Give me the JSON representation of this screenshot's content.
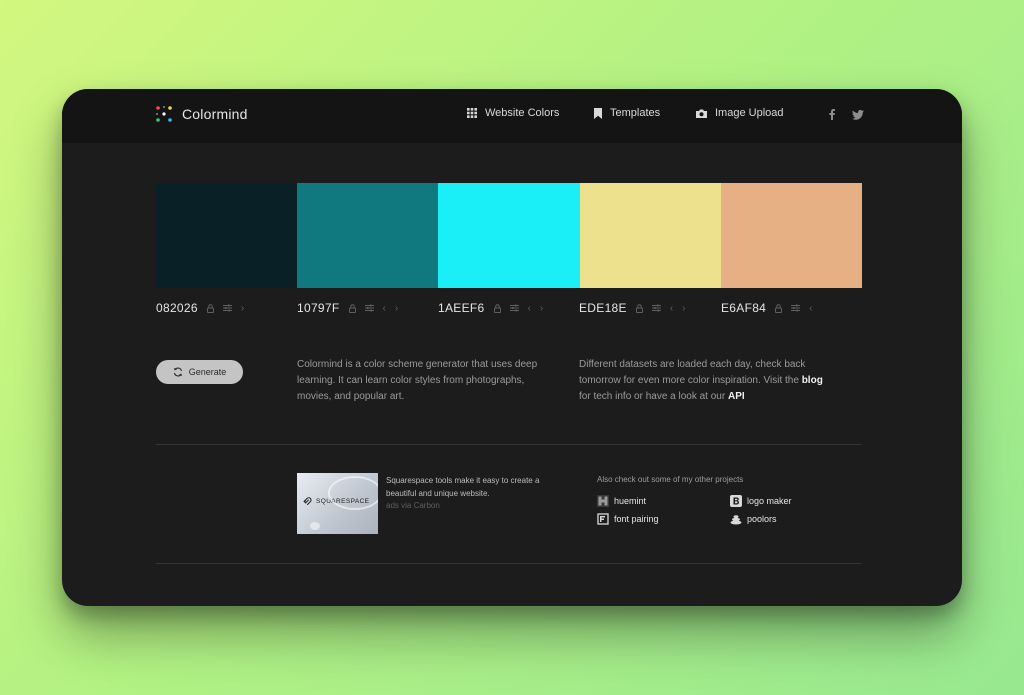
{
  "app": {
    "name": "Colormind"
  },
  "nav": {
    "items": [
      {
        "label": "Website Colors",
        "icon": "grid-icon"
      },
      {
        "label": "Templates",
        "icon": "bookmark-icon"
      },
      {
        "label": "Image Upload",
        "icon": "camera-icon"
      }
    ],
    "social": [
      "facebook-icon",
      "twitter-icon"
    ]
  },
  "palette": [
    {
      "hex": "082026",
      "color": "#082026"
    },
    {
      "hex": "10797F",
      "color": "#10797F"
    },
    {
      "hex": "1AEEF6",
      "color": "#1AEEF6"
    },
    {
      "hex": "EDE18E",
      "color": "#EDE18E"
    },
    {
      "hex": "E6AF84",
      "color": "#E6AF84"
    }
  ],
  "generate": {
    "label": "Generate"
  },
  "description": {
    "left": "Colormind is a color scheme generator that uses deep learning. It can learn color styles from photographs, movies, and popular art.",
    "right_pre": "Different datasets are loaded each day, check back tomorrow for even more color inspiration. Visit the",
    "right_blog": "blog",
    "right_mid": "for tech info or have a look at our",
    "right_api": "API"
  },
  "ad": {
    "image_text": "SQUARESPACE",
    "text": "Squarespace tools make it easy to create a beautiful and unique website.",
    "via": "ads via Carbon"
  },
  "projects": {
    "heading": "Also check out some of my other projects",
    "items": [
      {
        "label": "huemint",
        "icon": "huemint-icon"
      },
      {
        "label": "logo maker",
        "icon": "logo-maker-icon"
      },
      {
        "label": "font pairing",
        "icon": "font-pairing-icon"
      },
      {
        "label": "poolors",
        "icon": "poolors-icon"
      }
    ]
  }
}
